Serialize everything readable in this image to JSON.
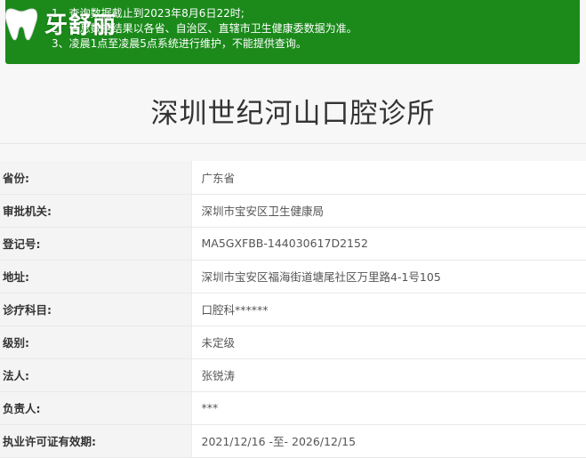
{
  "logo": {
    "text": "牙舒丽"
  },
  "notice": {
    "lines": [
      "1、查询数据截止到2023年8月6日22时;",
      "2、信息数据结果以各省、自治区、直辖市卫生健康委数据为准。",
      "3、凌晨1点至凌晨5点系统进行维护，不能提供查询。"
    ]
  },
  "title": "深圳世纪河山口腔诊所",
  "rows": [
    {
      "label": "省份:",
      "value": "广东省"
    },
    {
      "label": "审批机关:",
      "value": "深圳市宝安区卫生健康局"
    },
    {
      "label": "登记号:",
      "value": "MA5GXFBB-144030617D2152"
    },
    {
      "label": "地址:",
      "value": "深圳市宝安区福海街道塘尾社区万里路4-1号105"
    },
    {
      "label": "诊疗科目:",
      "value": "口腔科******"
    },
    {
      "label": "级别:",
      "value": "未定级"
    },
    {
      "label": "法人:",
      "value": "张锐涛"
    },
    {
      "label": "负责人:",
      "value": "***"
    },
    {
      "label": "执业许可证有效期:",
      "value": "2021/12/16 -至- 2026/12/15"
    }
  ],
  "colors": {
    "notice_bg": "#1b8a1b",
    "title": "#333333",
    "label_bg": "#f4f4f4"
  }
}
